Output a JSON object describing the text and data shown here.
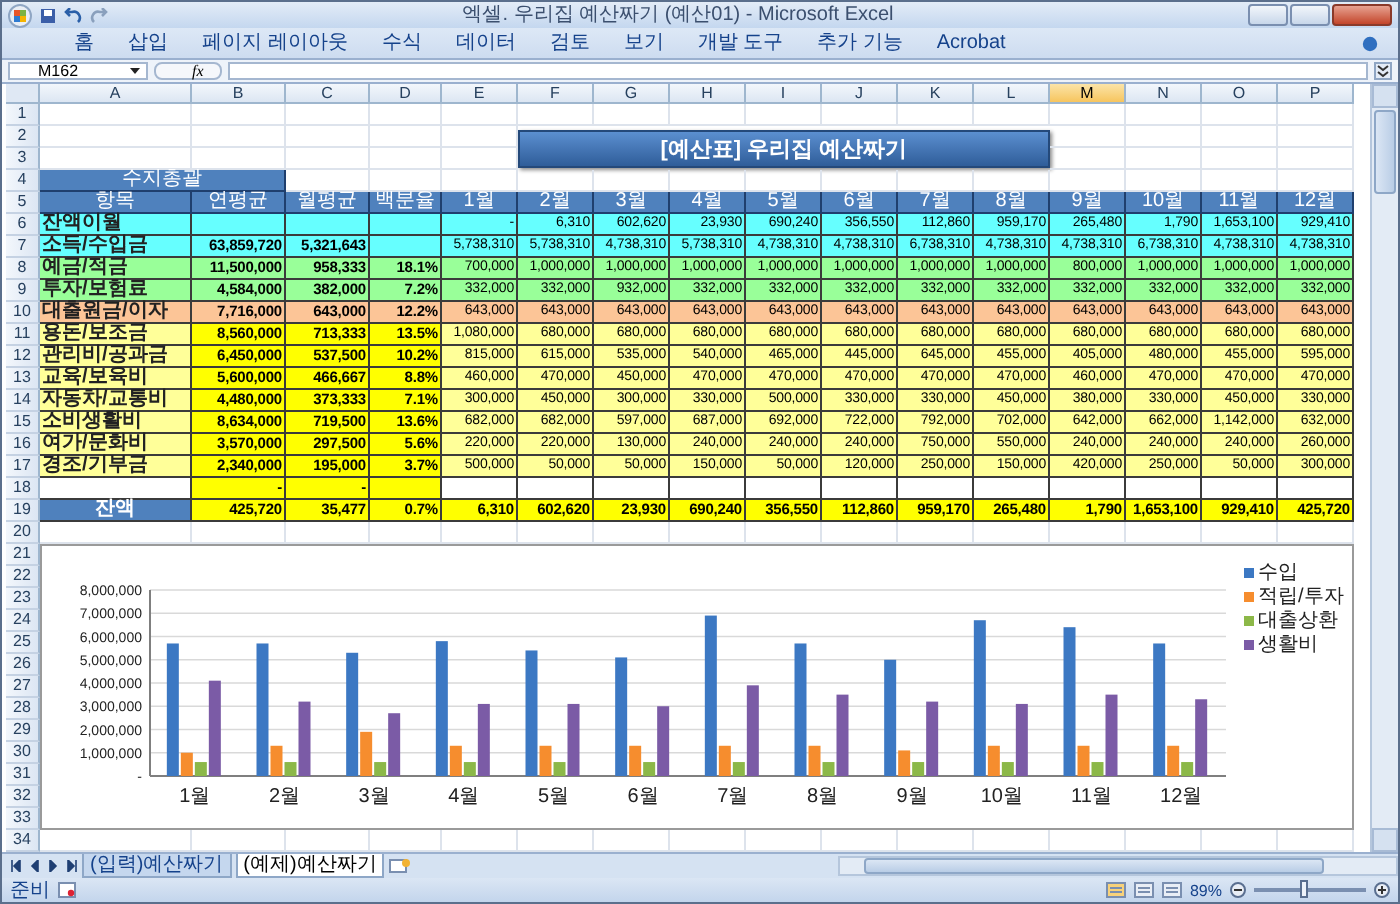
{
  "window": {
    "title": "엑셀. 우리집 예산짜기 (예산01) - Microsoft Excel"
  },
  "ribbon_tabs": [
    "홈",
    "삽입",
    "페이지 레이아웃",
    "수식",
    "데이터",
    "검토",
    "보기",
    "개발 도구",
    "추가 기능",
    "Acrobat"
  ],
  "formula_bar": {
    "name_box": "M162",
    "function_label": "fx"
  },
  "column_headers": [
    {
      "label": "A",
      "selected": false
    },
    {
      "label": "B",
      "selected": false
    },
    {
      "label": "C",
      "selected": false
    },
    {
      "label": "D",
      "selected": false
    },
    {
      "label": "E",
      "selected": false
    },
    {
      "label": "F",
      "selected": false
    },
    {
      "label": "G",
      "selected": false
    },
    {
      "label": "H",
      "selected": false
    },
    {
      "label": "I",
      "selected": false
    },
    {
      "label": "J",
      "selected": false
    },
    {
      "label": "K",
      "selected": false
    },
    {
      "label": "L",
      "selected": false
    },
    {
      "label": "M",
      "selected": true
    },
    {
      "label": "N",
      "selected": false
    },
    {
      "label": "O",
      "selected": false
    },
    {
      "label": "P",
      "selected": false
    }
  ],
  "row_numbers": [
    "1",
    "2",
    "3",
    "4",
    "5",
    "6",
    "7",
    "8",
    "9",
    "10",
    "11",
    "12",
    "13",
    "14",
    "15",
    "16",
    "17",
    "18",
    "19",
    "20",
    "21",
    "22",
    "23",
    "24",
    "25",
    "26",
    "27",
    "28",
    "29",
    "30",
    "31",
    "32",
    "33",
    "34"
  ],
  "sheet": {
    "title": "[예산표] 우리집 예산짜기",
    "group_header": "수지총괄",
    "header": [
      "항목",
      "연평균",
      "월평균",
      "백분율",
      "1월",
      "2월",
      "3월",
      "4월",
      "5월",
      "6월",
      "7월",
      "8월",
      "9월",
      "10월",
      "11월",
      "12월"
    ],
    "rows": [
      {
        "kind": "carry",
        "label": "잔액이월",
        "months": [
          "-",
          "6,310",
          "602,620",
          "23,930",
          "690,240",
          "356,550",
          "112,860",
          "959,170",
          "265,480",
          "1,790",
          "1,653,100",
          "929,410"
        ]
      },
      {
        "kind": "income",
        "label": "소득/수입금",
        "annual": "63,859,720",
        "monthly": "5,321,643",
        "months": [
          "5,738,310",
          "5,738,310",
          "4,738,310",
          "5,738,310",
          "4,738,310",
          "4,738,310",
          "6,738,310",
          "4,738,310",
          "4,738,310",
          "6,738,310",
          "4,738,310",
          "4,738,310"
        ]
      },
      {
        "kind": "saving",
        "label": "예금/적금",
        "annual": "11,500,000",
        "monthly": "958,333",
        "percent": "18.1%",
        "months": [
          "700,000",
          "1,000,000",
          "1,000,000",
          "1,000,000",
          "1,000,000",
          "1,000,000",
          "1,000,000",
          "1,000,000",
          "800,000",
          "1,000,000",
          "1,000,000",
          "1,000,000"
        ]
      },
      {
        "kind": "saving",
        "label": "투자/보험료",
        "annual": "4,584,000",
        "monthly": "382,000",
        "percent": "7.2%",
        "months": [
          "332,000",
          "332,000",
          "932,000",
          "332,000",
          "332,000",
          "332,000",
          "332,000",
          "332,000",
          "332,000",
          "332,000",
          "332,000",
          "332,000"
        ]
      },
      {
        "kind": "loan",
        "label": "대출원금/이자",
        "annual": "7,716,000",
        "monthly": "643,000",
        "percent": "12.2%",
        "months": [
          "643,000",
          "643,000",
          "643,000",
          "643,000",
          "643,000",
          "643,000",
          "643,000",
          "643,000",
          "643,000",
          "643,000",
          "643,000",
          "643,000"
        ]
      },
      {
        "kind": "expense",
        "label": "용돈/보조금",
        "annual": "8,560,000",
        "monthly": "713,333",
        "percent": "13.5%",
        "months": [
          "1,080,000",
          "680,000",
          "680,000",
          "680,000",
          "680,000",
          "680,000",
          "680,000",
          "680,000",
          "680,000",
          "680,000",
          "680,000",
          "680,000"
        ]
      },
      {
        "kind": "expense",
        "label": "관리비/공과금",
        "annual": "6,450,000",
        "monthly": "537,500",
        "percent": "10.2%",
        "months": [
          "815,000",
          "615,000",
          "535,000",
          "540,000",
          "465,000",
          "445,000",
          "645,000",
          "455,000",
          "405,000",
          "480,000",
          "455,000",
          "595,000"
        ]
      },
      {
        "kind": "expense",
        "label": "교육/보육비",
        "annual": "5,600,000",
        "monthly": "466,667",
        "percent": "8.8%",
        "months": [
          "460,000",
          "470,000",
          "450,000",
          "470,000",
          "470,000",
          "470,000",
          "470,000",
          "470,000",
          "460,000",
          "470,000",
          "470,000",
          "470,000"
        ]
      },
      {
        "kind": "expense",
        "label": "자동차/교통비",
        "annual": "4,480,000",
        "monthly": "373,333",
        "percent": "7.1%",
        "months": [
          "300,000",
          "450,000",
          "300,000",
          "330,000",
          "500,000",
          "330,000",
          "330,000",
          "450,000",
          "380,000",
          "330,000",
          "450,000",
          "330,000"
        ]
      },
      {
        "kind": "expense",
        "label": "소비생활비",
        "annual": "8,634,000",
        "monthly": "719,500",
        "percent": "13.6%",
        "months": [
          "682,000",
          "682,000",
          "597,000",
          "687,000",
          "692,000",
          "722,000",
          "792,000",
          "702,000",
          "642,000",
          "662,000",
          "1,142,000",
          "632,000"
        ]
      },
      {
        "kind": "expense",
        "label": "여가/문화비",
        "annual": "3,570,000",
        "monthly": "297,500",
        "percent": "5.6%",
        "months": [
          "220,000",
          "220,000",
          "130,000",
          "240,000",
          "240,000",
          "240,000",
          "750,000",
          "550,000",
          "240,000",
          "240,000",
          "240,000",
          "260,000"
        ]
      },
      {
        "kind": "expense",
        "label": "경조/기부금",
        "annual": "2,340,000",
        "monthly": "195,000",
        "percent": "3.7%",
        "months": [
          "500,000",
          "50,000",
          "50,000",
          "150,000",
          "50,000",
          "120,000",
          "250,000",
          "150,000",
          "420,000",
          "250,000",
          "50,000",
          "300,000"
        ]
      },
      {
        "kind": "blank",
        "annual": "-",
        "monthly": "-"
      },
      {
        "kind": "total",
        "label": "잔액",
        "annual": "425,720",
        "monthly": "35,477",
        "percent": "0.7%",
        "months": [
          "6,310",
          "602,620",
          "23,930",
          "690,240",
          "356,550",
          "112,860",
          "959,170",
          "265,480",
          "1,790",
          "1,653,100",
          "929,410",
          "425,720"
        ]
      }
    ],
    "chart_data": {
      "type": "bar",
      "categories": [
        "1월",
        "2월",
        "3월",
        "4월",
        "5월",
        "6월",
        "7월",
        "8월",
        "9월",
        "10월",
        "11월",
        "12월"
      ],
      "series": [
        {
          "name": "수입",
          "color": "#3c78c3",
          "values": [
            5700000,
            5700000,
            5300000,
            5800000,
            5400000,
            5100000,
            6900000,
            5700000,
            5000000,
            6700000,
            6400000,
            5700000
          ]
        },
        {
          "name": "적립/투자",
          "color": "#f68d2e",
          "values": [
            1000000,
            1300000,
            1900000,
            1300000,
            1300000,
            1300000,
            1300000,
            1300000,
            1100000,
            1300000,
            1300000,
            1300000
          ]
        },
        {
          "name": "대출상환",
          "color": "#8cb848",
          "values": [
            600000,
            600000,
            600000,
            600000,
            600000,
            600000,
            600000,
            600000,
            600000,
            600000,
            600000,
            600000
          ]
        },
        {
          "name": "생활비",
          "color": "#7b5ba6",
          "values": [
            4100000,
            3200000,
            2700000,
            3100000,
            3100000,
            3000000,
            3900000,
            3500000,
            3200000,
            3100000,
            3500000,
            3300000
          ]
        }
      ],
      "grid": true,
      "legend": true,
      "ylim": [
        0,
        8000000
      ],
      "yticks": [
        {
          "value": 0,
          "label": "-"
        },
        {
          "value": 1000000,
          "label": "1,000,000"
        },
        {
          "value": 2000000,
          "label": "2,000,000"
        },
        {
          "value": 3000000,
          "label": "3,000,000"
        },
        {
          "value": 4000000,
          "label": "4,000,000"
        },
        {
          "value": 5000000,
          "label": "5,000,000"
        },
        {
          "value": 6000000,
          "label": "6,000,000"
        },
        {
          "value": 7000000,
          "label": "7,000,000"
        },
        {
          "value": 8000000,
          "label": "8,000,000"
        }
      ]
    }
  },
  "sheet_tabs": [
    {
      "label": "(입력)예산짜기",
      "selected": false
    },
    {
      "label": "(예제)예산짜기",
      "selected": true
    }
  ],
  "status_bar": {
    "text": "준비",
    "zoom": {
      "reading": "89%",
      "level": 0.45
    }
  }
}
